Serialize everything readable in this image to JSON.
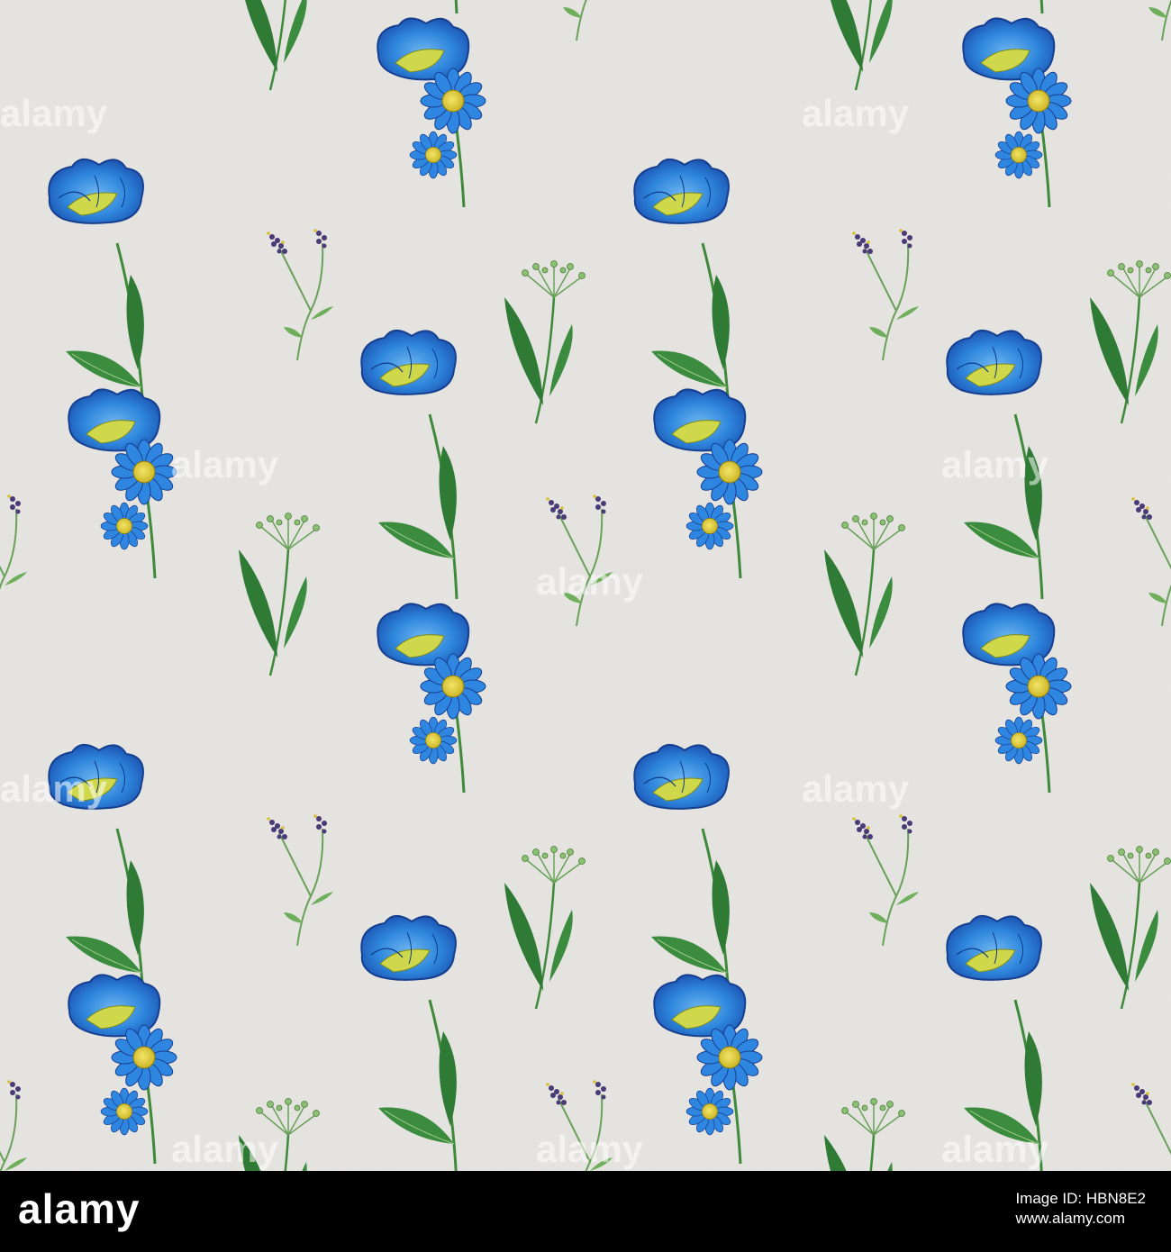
{
  "watermark": {
    "text": "alamy"
  },
  "footer": {
    "brand": "alamy",
    "image_id_label": "Image ID: HBN8E2",
    "site": "www.alamy.com"
  },
  "colors": {
    "paper": "#e6e5e1",
    "petal_dark": "#1f5fc0",
    "petal_light": "#3f95e6",
    "center": "#e8d23a",
    "leaf": "#2f7d32",
    "leaf_light": "#7fba6a",
    "lavender": "#4a3a78"
  }
}
